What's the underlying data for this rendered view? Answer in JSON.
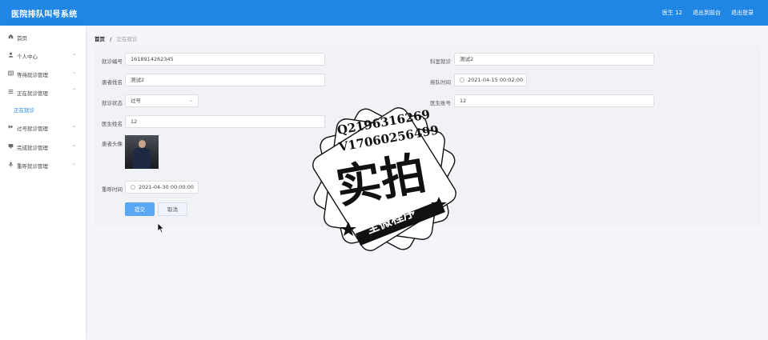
{
  "header": {
    "title": "医院排队叫号系统",
    "user": "医生 12",
    "back_to_front": "退出到前台",
    "logout": "退出登录"
  },
  "sidebar": {
    "items": [
      {
        "label": "首页",
        "icon": "home-icon",
        "arrow": ""
      },
      {
        "label": "个人中心",
        "icon": "user-icon",
        "arrow": "⌄"
      },
      {
        "label": "等待就诊管理",
        "icon": "document-icon",
        "arrow": "⌄"
      },
      {
        "label": "正在就诊管理",
        "icon": "list-icon",
        "arrow": "⌃"
      },
      {
        "label": "过号就诊管理",
        "icon": "forward-icon",
        "arrow": "⌄"
      },
      {
        "label": "完成就诊管理",
        "icon": "monitor-icon",
        "arrow": "⌄"
      },
      {
        "label": "重呼就诊管理",
        "icon": "microphone-icon",
        "arrow": "⌄"
      }
    ],
    "sub_item": "正在就诊"
  },
  "breadcrumb": {
    "home": "首页",
    "separator": "/",
    "current": "正在就诊"
  },
  "form": {
    "visit_number": {
      "label": "就诊编号",
      "value": "1618914262345"
    },
    "department": {
      "label": "科室就诊",
      "value": "测试2"
    },
    "patient_name": {
      "label": "患者姓名",
      "value": "测试2"
    },
    "queue_time": {
      "label": "排队时间",
      "value": "2021-04-15 00:02:00"
    },
    "visit_status": {
      "label": "就诊状态",
      "value": "过号"
    },
    "doctor_account": {
      "label": "医生账号",
      "value": "12"
    },
    "doctor_name": {
      "label": "医生姓名",
      "value": "12"
    },
    "patient_avatar": {
      "label": "患者头像"
    },
    "recall_time": {
      "label": "重呼时间",
      "value": "2021-04-30 00:00:00"
    },
    "submit_label": "提交",
    "cancel_label": "取消"
  },
  "watermark": {
    "qq": "Q2196316269",
    "wechat": "V17060256499",
    "main": "实拍",
    "ribbon": "全微程序"
  },
  "colors": {
    "header_bg": "#1f86e6",
    "primary": "#5aa8f3",
    "page_bg": "#f3f5fa"
  }
}
